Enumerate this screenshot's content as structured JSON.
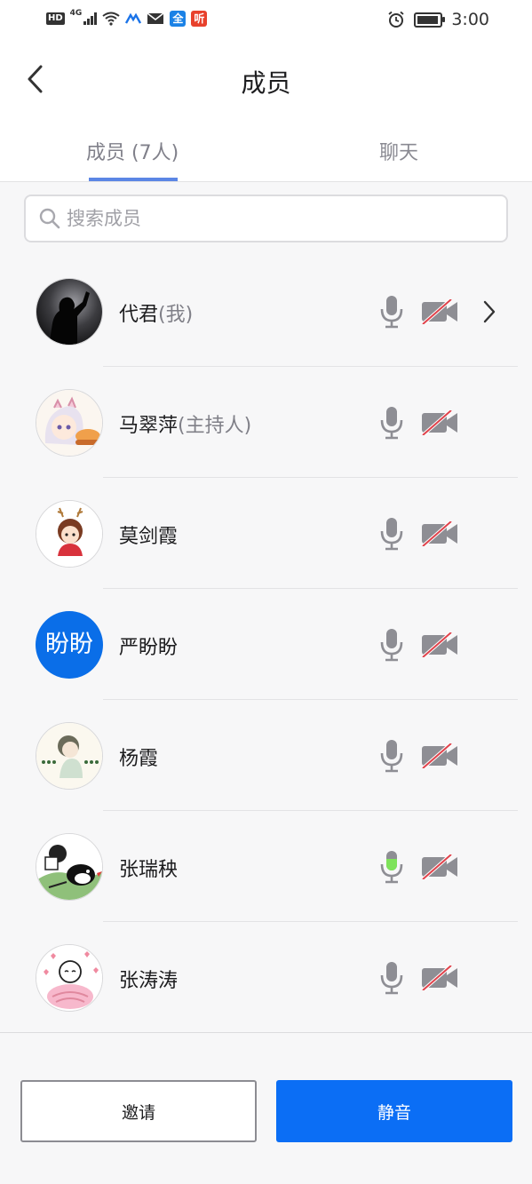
{
  "status_bar": {
    "network_label": "HD",
    "generation_label": "4G",
    "app_badge_1": "全",
    "app_badge_2": "听",
    "time": "3:00",
    "icons": [
      "signal-icon",
      "wifi-icon",
      "app-icon",
      "mail-icon",
      "alarm-icon",
      "battery-icon"
    ]
  },
  "header": {
    "title": "成员",
    "back_icon": "chevron-left-icon"
  },
  "tabs": {
    "members": "成员 (7人)",
    "chat": "聊天",
    "active": "members"
  },
  "search": {
    "placeholder": "搜索成员",
    "value": ""
  },
  "members": [
    {
      "name": "代君",
      "role": "(我)",
      "avatar_text": "",
      "mic_active": false,
      "camera_off": true,
      "has_chevron": true
    },
    {
      "name": "马翠萍",
      "role": "(主持人)",
      "avatar_text": "",
      "mic_active": false,
      "camera_off": true,
      "has_chevron": false
    },
    {
      "name": "莫剑霞",
      "role": "",
      "avatar_text": "",
      "mic_active": false,
      "camera_off": true,
      "has_chevron": false
    },
    {
      "name": "严盼盼",
      "role": "",
      "avatar_text": "盼盼",
      "mic_active": false,
      "camera_off": true,
      "has_chevron": false
    },
    {
      "name": "杨霞",
      "role": "",
      "avatar_text": "",
      "mic_active": false,
      "camera_off": true,
      "has_chevron": false
    },
    {
      "name": "张瑞秧",
      "role": "",
      "avatar_text": "",
      "mic_active": true,
      "camera_off": true,
      "has_chevron": false
    },
    {
      "name": "张涛涛",
      "role": "",
      "avatar_text": "",
      "mic_active": false,
      "camera_off": true,
      "has_chevron": false
    }
  ],
  "footer": {
    "invite_label": "邀请",
    "mute_label": "静音"
  },
  "colors": {
    "accent_blue": "#0b6ef5",
    "tab_underline": "#5b86e5",
    "icon_gray": "#8e8e94",
    "mic_active_green": "#7ee35a",
    "cam_slash_red": "#e0424b"
  }
}
